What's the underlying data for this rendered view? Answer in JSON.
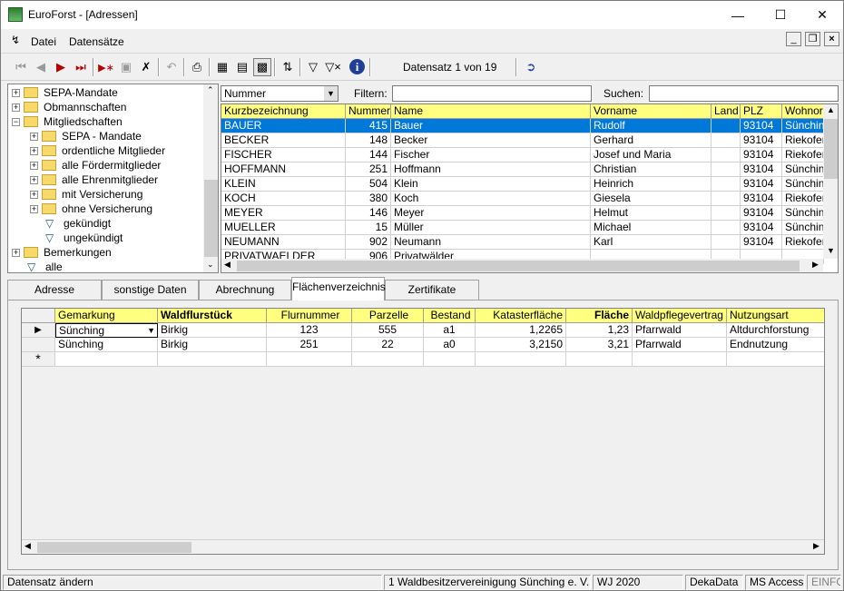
{
  "window": {
    "title": "EuroForst - [Adressen]"
  },
  "menu": {
    "file": "Datei",
    "records": "Datensätze"
  },
  "toolbar": {
    "record_status": "Datensatz 1 von 19"
  },
  "tree": {
    "items": [
      "SEPA-Mandate",
      "Obmannschaften",
      "Mitgliedschaften",
      "SEPA - Mandate",
      "ordentliche Mitglieder",
      "alle  Fördermitglieder",
      "alle  Ehrenmitglieder",
      "mit Versicherung",
      "ohne Versicherung",
      "gekündigt",
      "ungekündigt",
      "Bemerkungen",
      "alle"
    ]
  },
  "filterbar": {
    "sort_field": "Nummer",
    "filter_label": "Filtern:",
    "search_label": "Suchen:",
    "filter_value": "",
    "search_value": ""
  },
  "addresses": {
    "columns": [
      "Kurzbezeichnung",
      "Nummer",
      "Name",
      "Vorname",
      "Land",
      "PLZ",
      "Wohnort"
    ],
    "rows": [
      [
        "BAUER",
        "415",
        "Bauer",
        "Rudolf",
        "",
        "93104",
        "Sünching"
      ],
      [
        "BECKER",
        "148",
        "Becker",
        "Gerhard",
        "",
        "93104",
        "Riekofen"
      ],
      [
        "FISCHER",
        "144",
        "Fischer",
        "Josef und Maria",
        "",
        "93104",
        "Riekofen"
      ],
      [
        "HOFFMANN",
        "251",
        "Hoffmann",
        "Christian",
        "",
        "93104",
        "Sünching"
      ],
      [
        "KLEIN",
        "504",
        "Klein",
        "Heinrich",
        "",
        "93104",
        "Sünching"
      ],
      [
        "KOCH",
        "380",
        "Koch",
        "Giesela",
        "",
        "93104",
        "Riekofen"
      ],
      [
        "MEYER",
        "146",
        "Meyer",
        "Helmut",
        "",
        "93104",
        "Sünching"
      ],
      [
        "MUELLER",
        "15",
        "Müller",
        "Michael",
        "",
        "93104",
        "Sünching"
      ],
      [
        "NEUMANN",
        "902",
        "Neumann",
        "Karl",
        "",
        "93104",
        "Riekofen"
      ],
      [
        "PRIVATWAELDER",
        "906",
        "Privatwälder",
        "",
        "",
        "",
        ""
      ]
    ]
  },
  "tabs": [
    "Adresse",
    "sonstige Daten",
    "Abrechnung",
    "Flächenverzeichnis",
    "Zertifikate"
  ],
  "parcels": {
    "columns": [
      "Gemarkung",
      "Waldflurstück",
      "Flurnummer",
      "Parzelle",
      "Bestand",
      "Katasterfläche",
      "Fläche",
      "Waldpflegevertrag",
      "Nutzungsart"
    ],
    "rows": [
      [
        "Sünching",
        "Birkig",
        "123",
        "555",
        "a1",
        "1,2265",
        "1,23",
        "Pfarrwald",
        "Altdurchforstung"
      ],
      [
        "Sünching",
        "Birkig",
        "251",
        "22",
        "a0",
        "3,2150",
        "3,21",
        "Pfarrwald",
        "Endnutzung"
      ]
    ]
  },
  "status": {
    "main": "Datensatz ändern",
    "org": "1 Waldbesitzervereinigung Sünching e. V.",
    "year": "WJ 2020",
    "db": "DekaData",
    "engine": "MS Access",
    "mode": "EINFG"
  }
}
